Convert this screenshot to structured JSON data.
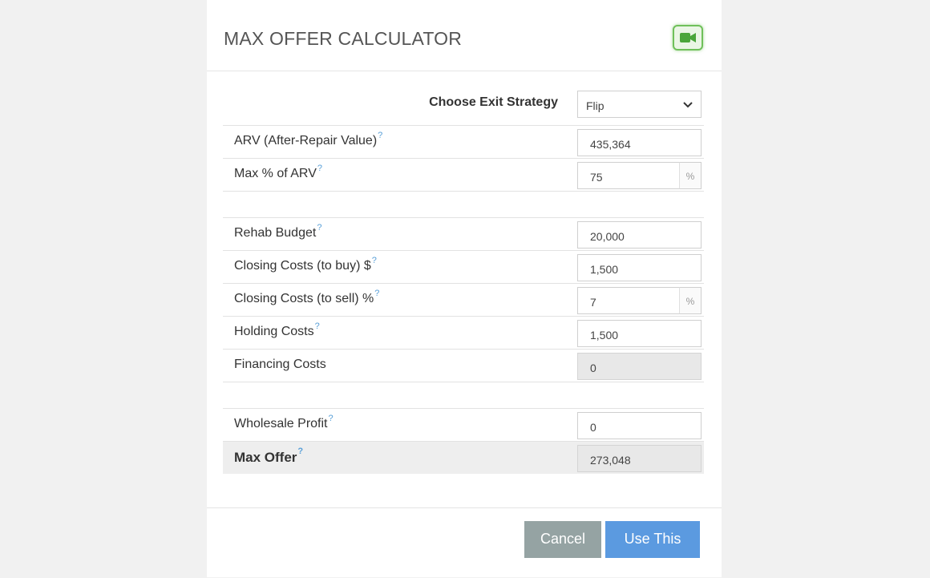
{
  "modal": {
    "title": "MAX OFFER CALCULATOR",
    "video_icon": "video-camera-icon",
    "accent_color": "#6fc05a"
  },
  "strategy": {
    "label": "Choose Exit Strategy",
    "selected": "Flip"
  },
  "fields": {
    "arv": {
      "label": "ARV (After-Repair Value)",
      "value": "435,364"
    },
    "max_pct": {
      "label": "Max % of ARV",
      "value": "75",
      "unit": "%"
    },
    "rehab": {
      "label": "Rehab Budget",
      "value": "20,000"
    },
    "closing_buy": {
      "label": "Closing Costs (to buy) $",
      "value": "1,500"
    },
    "closing_sell": {
      "label": "Closing Costs (to sell) %",
      "value": "7",
      "unit": "%"
    },
    "holding": {
      "label": "Holding Costs",
      "value": "1,500"
    },
    "financing": {
      "label": "Financing Costs",
      "value": "0"
    },
    "wholesale": {
      "label": "Wholesale Profit",
      "value": "0"
    },
    "max_offer": {
      "label": "Max Offer",
      "value": "273,048"
    }
  },
  "help_mark": "?",
  "footer": {
    "cancel_label": "Cancel",
    "use_label": "Use This",
    "cancel_color": "#95a3a3",
    "use_color": "#5b9ae0"
  }
}
